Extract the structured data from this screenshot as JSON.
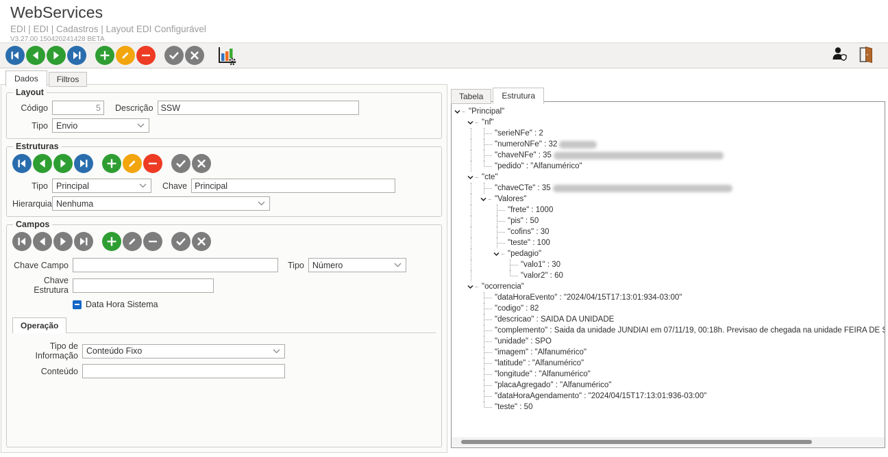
{
  "header": {
    "title": "WebServices",
    "breadcrumb": "EDI | EDI | Cadastros | Layout EDI Configurável",
    "version": "V3.27.00 150420241428 BETA"
  },
  "colors": {
    "nav_blue": "#2a6dad",
    "action_green": "#2f9e32",
    "edit_orange": "#f2a50c",
    "delete_red": "#ee3b23",
    "neutral_gray": "#7d7d7d",
    "checkbox_blue": "#1467c6",
    "door_brown": "#b3682b"
  },
  "toolbar": {
    "buttons": [
      {
        "name": "first-record",
        "glyph": "first",
        "color": "#2a6dad"
      },
      {
        "name": "previous-record",
        "glyph": "prev",
        "color": "#2f9e32"
      },
      {
        "name": "next-record",
        "glyph": "next",
        "color": "#2f9e32"
      },
      {
        "name": "last-record",
        "glyph": "last",
        "color": "#2a6dad"
      },
      {
        "name": "add-record",
        "glyph": "plus",
        "color": "#2f9e32",
        "gap": true
      },
      {
        "name": "edit-record",
        "glyph": "pencil",
        "color": "#f2a50c"
      },
      {
        "name": "delete-record",
        "glyph": "minus",
        "color": "#ee3b23"
      },
      {
        "name": "confirm",
        "glyph": "check",
        "color": "#7d7d7d",
        "gap": true
      },
      {
        "name": "cancel",
        "glyph": "cross",
        "color": "#7d7d7d"
      }
    ],
    "right_icons": [
      {
        "name": "user-permissions-icon"
      },
      {
        "name": "exit-door-icon"
      }
    ]
  },
  "main_tabs": [
    {
      "label": "Dados",
      "active": true
    },
    {
      "label": "Filtros",
      "active": false
    }
  ],
  "layout_section": {
    "legend": "Layout",
    "codigo_label": "Código",
    "codigo_value": "5",
    "descricao_label": "Descrição",
    "descricao_value": "SSW",
    "tipo_label": "Tipo",
    "tipo_value": "Envio"
  },
  "estruturas_section": {
    "legend": "Estruturas",
    "buttons": [
      {
        "name": "estruturas-first",
        "glyph": "first",
        "color": "#2a6dad"
      },
      {
        "name": "estruturas-previous",
        "glyph": "prev",
        "color": "#2f9e32"
      },
      {
        "name": "estruturas-next",
        "glyph": "next",
        "color": "#2f9e32"
      },
      {
        "name": "estruturas-last",
        "glyph": "last",
        "color": "#2a6dad"
      },
      {
        "name": "estruturas-add",
        "glyph": "plus",
        "color": "#2f9e32",
        "gap": true
      },
      {
        "name": "estruturas-edit",
        "glyph": "pencil",
        "color": "#f2a50c"
      },
      {
        "name": "estruturas-delete",
        "glyph": "minus",
        "color": "#ee3b23"
      },
      {
        "name": "estruturas-confirm",
        "glyph": "check",
        "color": "#7d7d7d",
        "gap": true
      },
      {
        "name": "estruturas-cancel",
        "glyph": "cross",
        "color": "#7d7d7d"
      }
    ],
    "tipo_label": "Tipo",
    "tipo_value": "Principal",
    "chave_label": "Chave",
    "chave_value": "Principal",
    "hierarquia_label": "Hierarquia",
    "hierarquia_value": "Nenhuma"
  },
  "campos_section": {
    "legend": "Campos",
    "buttons": [
      {
        "name": "campos-first",
        "glyph": "first",
        "color": "#7d7d7d"
      },
      {
        "name": "campos-previous",
        "glyph": "prev",
        "color": "#7d7d7d"
      },
      {
        "name": "campos-next",
        "glyph": "next",
        "color": "#7d7d7d"
      },
      {
        "name": "campos-last",
        "glyph": "last",
        "color": "#7d7d7d"
      },
      {
        "name": "campos-add",
        "glyph": "plus",
        "color": "#2f9e32",
        "gap": true
      },
      {
        "name": "campos-edit",
        "glyph": "pencil",
        "color": "#7d7d7d"
      },
      {
        "name": "campos-delete",
        "glyph": "minus",
        "color": "#7d7d7d"
      },
      {
        "name": "campos-confirm",
        "glyph": "check",
        "color": "#7d7d7d",
        "gap": true
      },
      {
        "name": "campos-cancel",
        "glyph": "cross",
        "color": "#7d7d7d"
      }
    ],
    "chave_campo_label": "Chave Campo",
    "chave_campo_value": "",
    "tipo_label": "Tipo",
    "tipo_value": "Número",
    "chave_estrutura_label": "Chave Estrutura",
    "chave_estrutura_value": "",
    "checkbox_label": "Data Hora Sistema",
    "checkbox_state": "checked-dash"
  },
  "operacao_section": {
    "tab_label": "Operação",
    "tipo_informacao_label": "Tipo de Informação",
    "tipo_informacao_value": "Conteúdo Fixo",
    "conteudo_label": "Conteúdo",
    "conteudo_value": ""
  },
  "right_panel": {
    "tabs": [
      {
        "label": "Tabela",
        "active": false
      },
      {
        "label": "Estrutura",
        "active": true
      }
    ],
    "tree": {
      "rows": [
        {
          "level": 0,
          "type": "branch",
          "text": "\"Principal\""
        },
        {
          "level": 1,
          "type": "branch",
          "text": "\"nf\""
        },
        {
          "level": 2,
          "type": "leaf",
          "text": "\"serieNFe\" : 2"
        },
        {
          "level": 2,
          "type": "leaf",
          "text": "\"numeroNFe\" : 32",
          "blur": 55
        },
        {
          "level": 2,
          "type": "leaf",
          "text": "\"chaveNFe\" : 35",
          "blur": 248
        },
        {
          "level": 2,
          "type": "leaf",
          "text": "\"pedido\" : \"Alfanumérico\""
        },
        {
          "level": 1,
          "type": "branch",
          "text": "\"cte\""
        },
        {
          "level": 2,
          "type": "leaf",
          "text": "\"chaveCTe\" : 35",
          "blur": 262
        },
        {
          "level": 2,
          "type": "branch",
          "text": "\"Valores\""
        },
        {
          "level": 3,
          "type": "leaf",
          "text": "\"frete\" : 1000"
        },
        {
          "level": 3,
          "type": "leaf",
          "text": "\"pis\" : 50"
        },
        {
          "level": 3,
          "type": "leaf",
          "text": "\"cofins\" : 30"
        },
        {
          "level": 3,
          "type": "leaf",
          "text": "\"teste\" : 100"
        },
        {
          "level": 3,
          "type": "branch",
          "text": "\"pedagio\""
        },
        {
          "level": 4,
          "type": "leaf",
          "text": "\"valo1\" : 30"
        },
        {
          "level": 4,
          "type": "leaf",
          "text": "\"valor2\" : 60"
        },
        {
          "level": 1,
          "type": "branch",
          "text": "\"ocorrencia\""
        },
        {
          "level": 2,
          "type": "leaf",
          "text": "\"dataHoraEvento\" : \"2024/04/15T17:13:01:934-03:00\""
        },
        {
          "level": 2,
          "type": "leaf",
          "text": "\"codigo\" : 82"
        },
        {
          "level": 2,
          "type": "leaf",
          "text": "\"descricao\" : SAIDA DA UNIDADE"
        },
        {
          "level": 2,
          "type": "leaf",
          "text": "\"complemento\" : Saida da unidade JUNDIAI em 07/11/19, 00:18h. Previsao de chegada na unidade FEIRA DE SANTANA"
        },
        {
          "level": 2,
          "type": "leaf",
          "text": "\"unidade\" : SPO"
        },
        {
          "level": 2,
          "type": "leaf",
          "text": "\"imagem\" : \"Alfanumérico\""
        },
        {
          "level": 2,
          "type": "leaf",
          "text": "\"latitude\" : \"Alfanumérico\""
        },
        {
          "level": 2,
          "type": "leaf",
          "text": "\"longitude\" : \"Alfanumérico\""
        },
        {
          "level": 2,
          "type": "leaf",
          "text": "\"placaAgregado\" : \"Alfanumérico\""
        },
        {
          "level": 2,
          "type": "leaf",
          "text": "\"dataHoraAgendamento\" : \"2024/04/15T17:13:01:936-03:00\""
        },
        {
          "level": 2,
          "type": "leaf",
          "text": "\"teste\" : 50"
        }
      ]
    }
  }
}
